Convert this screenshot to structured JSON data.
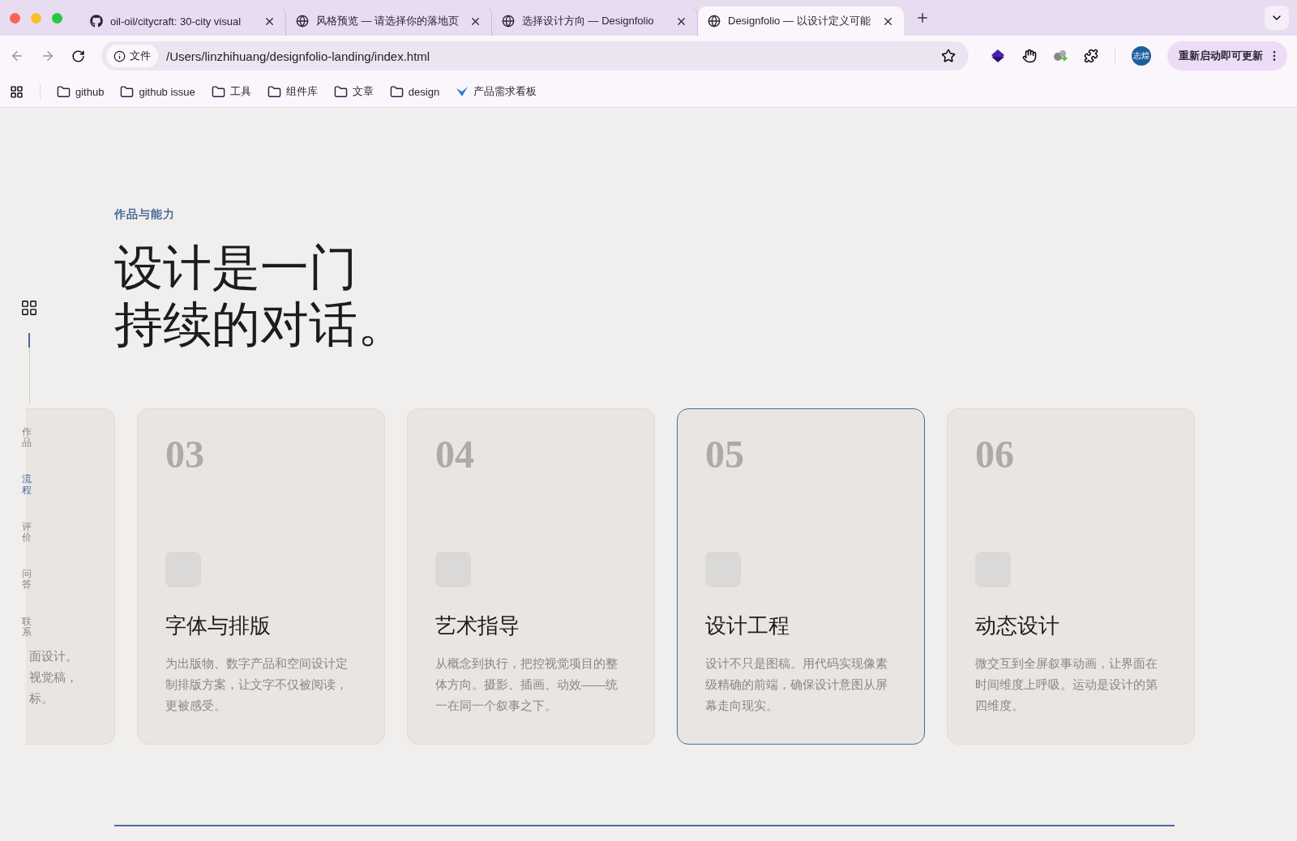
{
  "browser": {
    "tabs": [
      {
        "title": "oil-oil/citycraft: 30-city visual",
        "kind": "repo",
        "selected": false
      },
      {
        "title": "风格预览 — 请选择你的落地页",
        "kind": "page",
        "selected": false
      },
      {
        "title": "选择设计方向 — Designfolio",
        "kind": "page",
        "selected": false
      },
      {
        "title": "Designfolio — 以设计定义可能",
        "kind": "page",
        "selected": true
      }
    ],
    "address": {
      "badge": "文件",
      "url": "/Users/linzhihuang/designfolio-landing/index.html"
    },
    "avatar": "志煌",
    "update_button": "重新启动即可更新",
    "bookmarks": [
      {
        "label": "github",
        "kind": "folder"
      },
      {
        "label": "github issue",
        "kind": "folder"
      },
      {
        "label": "工具",
        "kind": "folder"
      },
      {
        "label": "组件库",
        "kind": "folder"
      },
      {
        "label": "文章",
        "kind": "folder"
      },
      {
        "label": "design",
        "kind": "folder"
      },
      {
        "label": "产品需求看板",
        "kind": "app"
      }
    ]
  },
  "page": {
    "eyebrow": "作品与能力",
    "heading": [
      "设计是一门",
      "持续的对话。"
    ],
    "side_nav": [
      {
        "label": "作品",
        "selected": false
      },
      {
        "label": "流程",
        "selected": true
      },
      {
        "label": "评价",
        "selected": false
      },
      {
        "label": "问答",
        "selected": false
      },
      {
        "label": "联系",
        "selected": false
      }
    ],
    "partial_card": {
      "lines": [
        "面设计。",
        "视觉稿，",
        "标。"
      ]
    },
    "cards": [
      {
        "number": "03",
        "title": "字体与排版",
        "description": "为出版物、数字产品和空间设计定制排版方案，让文字不仅被阅读，更被感受。",
        "selected": false
      },
      {
        "number": "04",
        "title": "艺术指导",
        "description": "从概念到执行，把控视觉项目的整体方向。摄影、插画、动效——统一在同一个叙事之下。",
        "selected": false
      },
      {
        "number": "05",
        "title": "设计工程",
        "description": "设计不只是图稿。用代码实现像素级精确的前端，确保设计意图从屏幕走向现实。",
        "selected": true
      },
      {
        "number": "06",
        "title": "动态设计",
        "description": "微交互到全屏叙事动画，让界面在时间维度上呼吸。运动是设计的第四维度。",
        "selected": false
      }
    ]
  }
}
